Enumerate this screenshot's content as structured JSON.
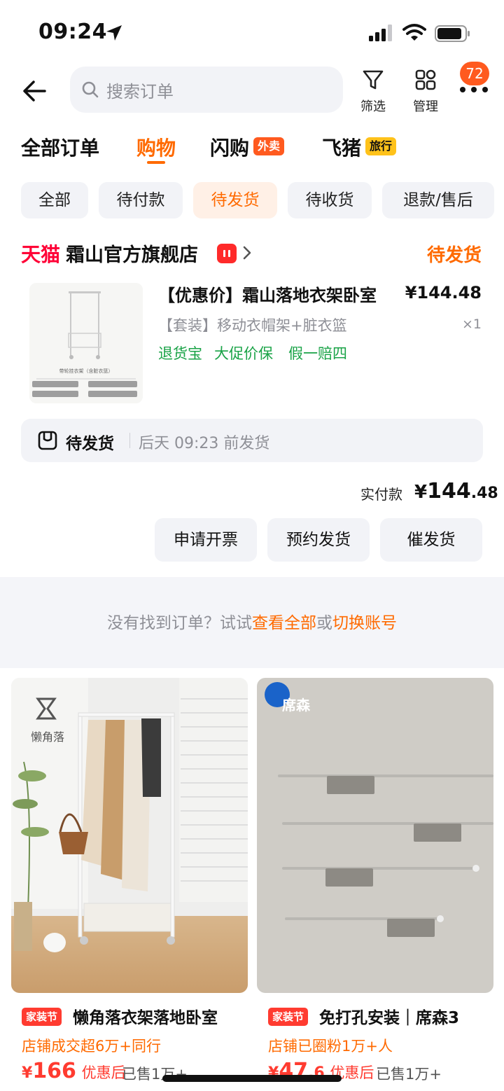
{
  "status_bar": {
    "time": "09:24"
  },
  "search": {
    "placeholder": "搜索订单"
  },
  "tools": {
    "filter_label": "筛选",
    "manage_label": "管理",
    "more_badge": "72"
  },
  "category_tabs": [
    {
      "label": "全部订单"
    },
    {
      "label": "购物",
      "active": true
    },
    {
      "label": "闪购",
      "tag": "外卖"
    },
    {
      "label": "飞猪",
      "tag": "旅行"
    }
  ],
  "status_tabs": [
    "全部",
    "待付款",
    "待发货",
    "待收货",
    "退款/售后"
  ],
  "order": {
    "platform": "天猫",
    "shop_name": "霜山官方旗舰店",
    "status": "待发货",
    "item": {
      "title": "【优惠价】霜山落地衣架卧室",
      "price": "¥144.48",
      "sku": "【套装】移动衣帽架+脏衣篮",
      "qty": "×1",
      "services": [
        "退货宝",
        "大促价保",
        "假一赔四"
      ],
      "thumb_caption": "带轮挂衣架（含脏衣篮）"
    },
    "shipping": {
      "status": "待发货",
      "time": "后天 09:23 前发货"
    },
    "paid_label": "实付款",
    "paid_currency": "¥",
    "paid_int": "144",
    "paid_dec": ".48",
    "actions": [
      "申请开票",
      "预约发货",
      "催发货"
    ]
  },
  "not_found": {
    "prefix": "没有找到订单？试试",
    "link1": "查看全部",
    "middle": "或",
    "link2": "切换账号"
  },
  "recommendations": [
    {
      "brand": "懒角落",
      "tag": "家装节",
      "title": "懒角落衣架落地卧室",
      "subtitle": "店铺成交超6万+同行",
      "currency": "¥",
      "price": "166",
      "price_suffix": "优惠后",
      "sold": "已售1万+"
    },
    {
      "brand": "席森",
      "tag": "家装节",
      "title": "免打孔安装｜席森3",
      "subtitle": "店铺已圈粉1万+人",
      "currency": "¥",
      "price": "47",
      "price_dec": ".6",
      "price_suffix": "优惠后",
      "sold": "已售1万+"
    }
  ],
  "colors": {
    "accent": "#ff6a00",
    "tmall": "#ff0036",
    "service_green": "#1aa347",
    "promo_red": "#ff3b30"
  }
}
